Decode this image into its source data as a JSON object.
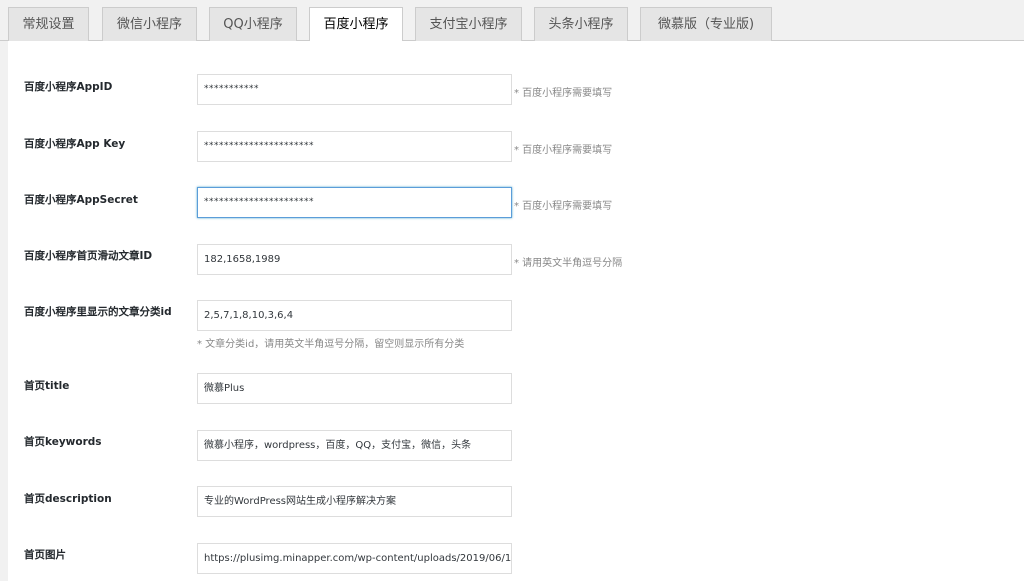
{
  "tabs": [
    {
      "label": "常规设置",
      "active": false
    },
    {
      "label": "微信小程序",
      "active": false
    },
    {
      "label": "QQ小程序",
      "active": false
    },
    {
      "label": "百度小程序",
      "active": true
    },
    {
      "label": "支付宝小程序",
      "active": false
    },
    {
      "label": "头条小程序",
      "active": false
    },
    {
      "label": "微慕版（专业版)",
      "active": false
    }
  ],
  "fields": [
    {
      "label": "百度小程序AppID",
      "value": "***********",
      "hint": "* 百度小程序需要填写"
    },
    {
      "label": "百度小程序App Key",
      "value": "**********************",
      "hint": "* 百度小程序需要填写"
    },
    {
      "label": "百度小程序AppSecret",
      "value": "**********************",
      "hint": "* 百度小程序需要填写"
    },
    {
      "label": "百度小程序首页滑动文章ID",
      "value": "182,1658,1989",
      "hint": "* 请用英文半角逗号分隔"
    },
    {
      "label": "百度小程序里显示的文章分类id",
      "value": "2,5,7,1,8,10,3,6,4",
      "hint": "* 文章分类id，请用英文半角逗号分隔，留空则显示所有分类"
    },
    {
      "label": "首页title",
      "value": "微慕Plus"
    },
    {
      "label": "首页keywords",
      "value": "微慕小程序，wordpress，百度，QQ，支付宝，微信，头条"
    },
    {
      "label": "首页description",
      "value": "专业的WordPress网站生成小程序解决方案"
    },
    {
      "label": "首页图片",
      "value": "https://plusimg.minapper.com/wp-content/uploads/2019/06/1"
    }
  ]
}
